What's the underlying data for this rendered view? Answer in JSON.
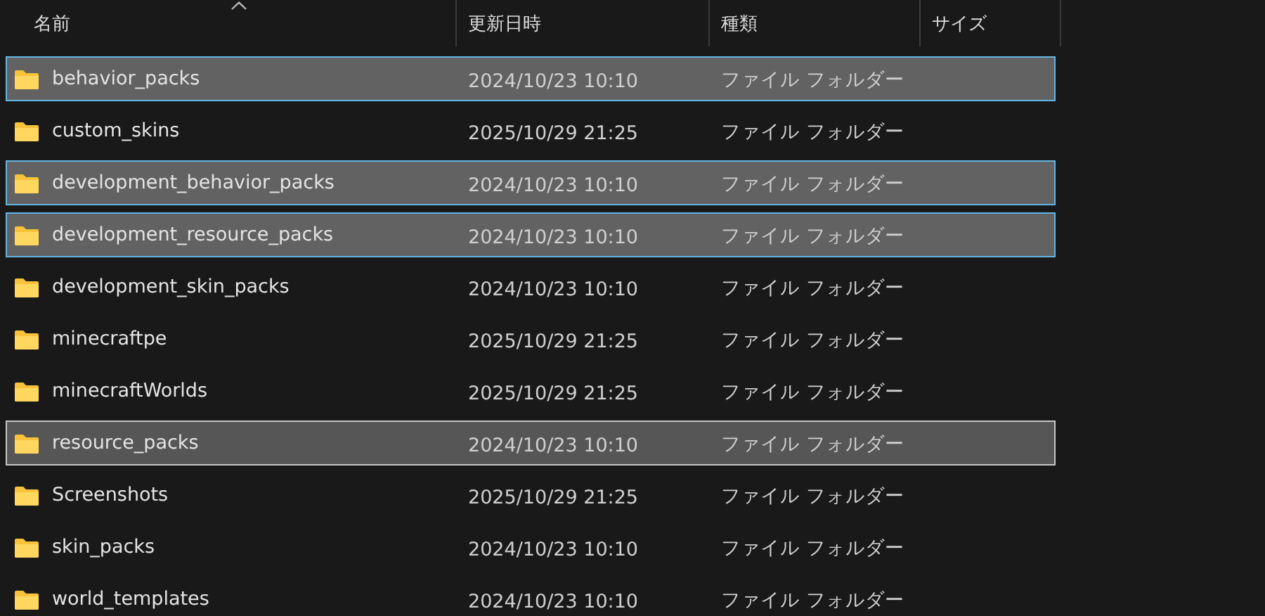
{
  "columns": [
    {
      "label": "名前",
      "sorted": true
    },
    {
      "label": "更新日時",
      "sorted": false
    },
    {
      "label": "種類",
      "sorted": false
    },
    {
      "label": "サイズ",
      "sorted": false
    }
  ],
  "rows": [
    {
      "name": "behavior_packs",
      "modified": "2024/10/23 10:10",
      "type": "ファイル フォルダー",
      "selected": true,
      "focused": false
    },
    {
      "name": "custom_skins",
      "modified": "2025/10/29 21:25",
      "type": "ファイル フォルダー",
      "selected": false,
      "focused": false
    },
    {
      "name": "development_behavior_packs",
      "modified": "2024/10/23 10:10",
      "type": "ファイル フォルダー",
      "selected": true,
      "focused": false
    },
    {
      "name": "development_resource_packs",
      "modified": "2024/10/23 10:10",
      "type": "ファイル フォルダー",
      "selected": true,
      "focused": false
    },
    {
      "name": "development_skin_packs",
      "modified": "2024/10/23 10:10",
      "type": "ファイル フォルダー",
      "selected": false,
      "focused": false
    },
    {
      "name": "minecraftpe",
      "modified": "2025/10/29 21:25",
      "type": "ファイル フォルダー",
      "selected": false,
      "focused": false
    },
    {
      "name": "minecraftWorlds",
      "modified": "2025/10/29 21:25",
      "type": "ファイル フォルダー",
      "selected": false,
      "focused": false
    },
    {
      "name": "resource_packs",
      "modified": "2024/10/23 10:10",
      "type": "ファイル フォルダー",
      "selected": true,
      "focused": true
    },
    {
      "name": "Screenshots",
      "modified": "2025/10/29 21:25",
      "type": "ファイル フォルダー",
      "selected": false,
      "focused": false
    },
    {
      "name": "skin_packs",
      "modified": "2024/10/23 10:10",
      "type": "ファイル フォルダー",
      "selected": false,
      "focused": false
    },
    {
      "name": "world_templates",
      "modified": "2024/10/23 10:10",
      "type": "ファイル フォルダー",
      "selected": false,
      "focused": false
    }
  ]
}
